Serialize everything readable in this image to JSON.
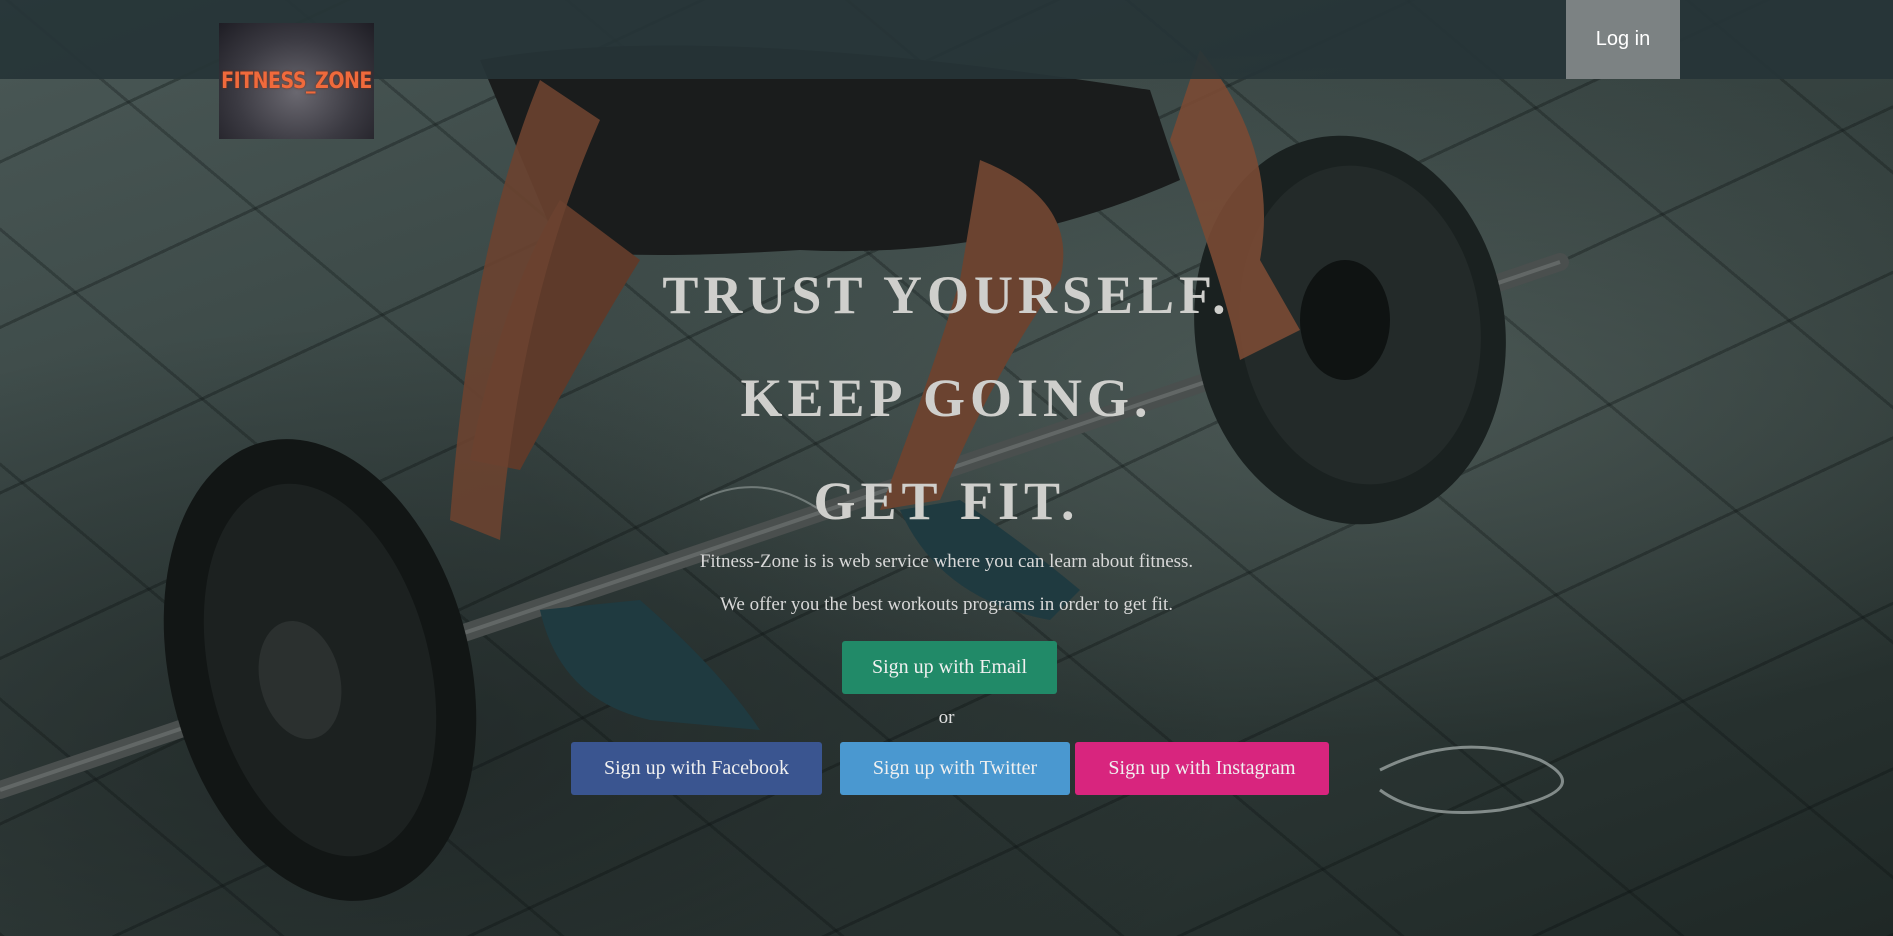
{
  "navbar": {
    "logo_text": "FITNESS_ZONE",
    "login_label": "Log in"
  },
  "hero": {
    "headlines": [
      "TRUST YOURSELF.",
      "KEEP GOING.",
      "GET FIT."
    ],
    "description_1": "Fitness-Zone is is web service where you can learn about fitness.",
    "description_2": "We offer you the best workouts programs in order to get fit.",
    "email_button": "Sign up with Email",
    "or_text": "or",
    "facebook_button": "Sign up with Facebook",
    "twitter_button": "Sign up with Twitter",
    "instagram_button": "Sign up with Instagram"
  },
  "colors": {
    "email": "#218a68",
    "facebook": "#3a5590",
    "twitter": "#4a98d0",
    "instagram": "#d8257e",
    "logo_text": "#f06a3c"
  }
}
